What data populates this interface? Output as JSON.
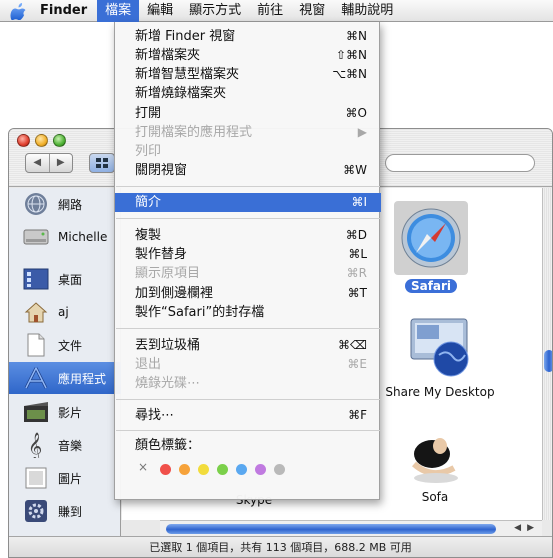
{
  "menubar": {
    "app": "Finder",
    "items": [
      "檔案",
      "編輯",
      "顯示方式",
      "前往",
      "視窗",
      "輔助說明"
    ]
  },
  "menu": {
    "items": [
      {
        "label": "新增 Finder 視窗",
        "shortcut": "⌘N",
        "enabled": true
      },
      {
        "label": "新增檔案夾",
        "shortcut": "⇧⌘N",
        "enabled": true
      },
      {
        "label": "新增智慧型檔案夾",
        "shortcut": "⌥⌘N",
        "enabled": true
      },
      {
        "label": "新增燒錄檔案夾",
        "shortcut": "",
        "enabled": true
      },
      {
        "label": "打開",
        "shortcut": "⌘O",
        "enabled": true
      },
      {
        "label": "打開檔案的應用程式",
        "shortcut": "▶",
        "enabled": false
      },
      {
        "label": "列印",
        "shortcut": "",
        "enabled": false
      },
      {
        "label": "關閉視窗",
        "shortcut": "⌘W",
        "enabled": true
      },
      {
        "label": "簡介",
        "shortcut": "⌘I",
        "enabled": true,
        "highlighted": true
      },
      {
        "label": "複製",
        "shortcut": "⌘D",
        "enabled": true
      },
      {
        "label": "製作替身",
        "shortcut": "⌘L",
        "enabled": true
      },
      {
        "label": "顯示原項目",
        "shortcut": "⌘R",
        "enabled": false
      },
      {
        "label": "加到側邊欄裡",
        "shortcut": "⌘T",
        "enabled": true
      },
      {
        "label": "製作“Safari”的封存檔",
        "shortcut": "",
        "enabled": true
      },
      {
        "label": "丟到垃圾桶",
        "shortcut": "⌘⌫",
        "enabled": true
      },
      {
        "label": "退出",
        "shortcut": "⌘E",
        "enabled": false
      },
      {
        "label": "燒錄光碟⋯",
        "shortcut": "",
        "enabled": false
      },
      {
        "label": "尋找⋯",
        "shortcut": "⌘F",
        "enabled": true
      }
    ],
    "color_label_title": "顏色標籤：",
    "label_none": "×",
    "label_colors": [
      "#f0504a",
      "#f6a23a",
      "#f2dc3c",
      "#7bd04a",
      "#5aa8f0",
      "#c07ae0",
      "#b9b9b9"
    ]
  },
  "window": {
    "nav_back": "◀",
    "nav_forward": "▶",
    "status": "已選取 1 個項目，共有 113 個項目，688.2 MB 可用"
  },
  "sidebar": {
    "items": [
      {
        "label": "網路",
        "icon": "network-globe-icon"
      },
      {
        "label": "Michelle",
        "icon": "hard-drive-icon"
      },
      {
        "label": "桌面",
        "icon": "desktop-icon"
      },
      {
        "label": "aj",
        "icon": "home-icon"
      },
      {
        "label": "文件",
        "icon": "document-icon"
      },
      {
        "label": "應用程式",
        "icon": "applications-icon",
        "selected": true
      },
      {
        "label": "影片",
        "icon": "movies-icon"
      },
      {
        "label": "音樂",
        "icon": "music-icon"
      },
      {
        "label": "圖片",
        "icon": "pictures-icon"
      },
      {
        "label": "賺到",
        "icon": "gear-icon"
      }
    ]
  },
  "content": {
    "apps": [
      {
        "label": "Safari",
        "selected": true
      },
      {
        "label": "Share My Desktop"
      },
      {
        "label": "Skype"
      },
      {
        "label": "Sofa"
      }
    ]
  }
}
